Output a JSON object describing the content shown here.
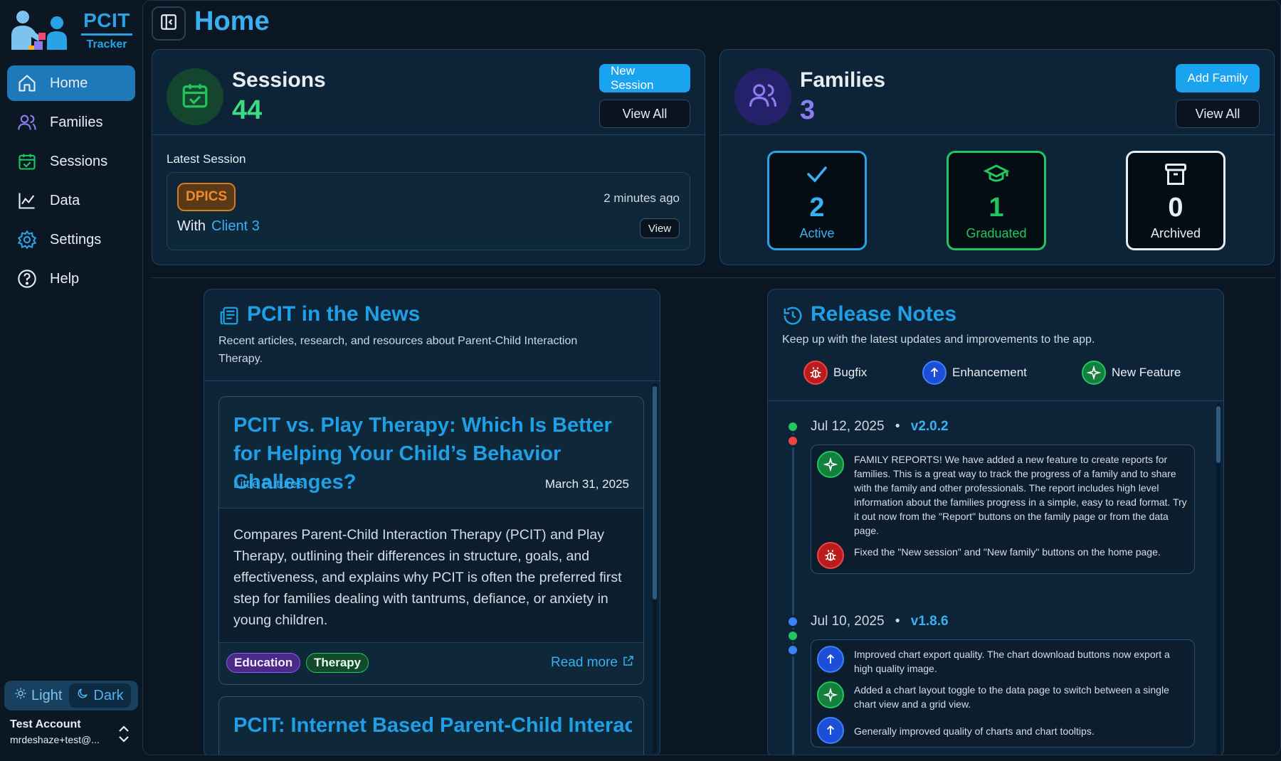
{
  "app": {
    "name": "PCIT",
    "sub": "Tracker"
  },
  "page_title": "Home",
  "nav": [
    {
      "label": "Home"
    },
    {
      "label": "Families"
    },
    {
      "label": "Sessions"
    },
    {
      "label": "Data"
    },
    {
      "label": "Settings"
    },
    {
      "label": "Help"
    }
  ],
  "theme": {
    "light": "Light",
    "dark": "Dark"
  },
  "account": {
    "name": "Test Account",
    "email": "mrdeshaze+test@..."
  },
  "sessions": {
    "title": "Sessions",
    "count": "44",
    "new_label": "New Session",
    "view_all": "View All",
    "latest_label": "Latest Session",
    "latest": {
      "type": "DPICS",
      "ago": "2 minutes ago",
      "with": "With",
      "client": "Client 3",
      "view": "View"
    }
  },
  "families": {
    "title": "Families",
    "count": "3",
    "add_label": "Add Family",
    "view_all": "View All",
    "stats": [
      {
        "value": "2",
        "label": "Active"
      },
      {
        "value": "1",
        "label": "Graduated"
      },
      {
        "value": "0",
        "label": "Archived"
      }
    ]
  },
  "news": {
    "title": "PCIT in the News",
    "subtitle": "Recent articles, research, and resources about Parent-Child Interaction Therapy.",
    "articles": [
      {
        "title": "PCIT vs. Play Therapy: Which Is Better for Helping Your Child’s Behavior Challenges?",
        "source": "Little Futures",
        "date": "March 31, 2025",
        "summary": "Compares Parent-Child Interaction Therapy (PCIT) and Play Therapy, outlining their differences in structure, goals, and effectiveness, and explains why PCIT is often the preferred first step for families dealing with tantrums, defiance, or anxiety in young children.",
        "tags": [
          "Education",
          "Therapy"
        ],
        "read_more": "Read more"
      },
      {
        "title": "PCIT: Internet Based Parent-Child Interaction Th..."
      }
    ]
  },
  "release": {
    "title": "Release Notes",
    "subtitle": "Keep up with the latest updates and improvements to the app.",
    "legend": [
      "Bugfix",
      "Enhancement",
      "New Feature"
    ],
    "entries": [
      {
        "date": "Jul 12, 2025",
        "sep": "•",
        "version": "v2.0.2",
        "items": [
          {
            "type": "feature",
            "text": "FAMILY REPORTS! We have added a new feature to create reports for families. This is a great way to track the progress of a family and to share with the family and other professionals. The report includes high level information about the families progress in a simple, easy to read format. Try it out now from the \"Report\" buttons on the family page or from the data page."
          },
          {
            "type": "bugfix",
            "text": "Fixed the \"New session\" and \"New family\" buttons on the home page."
          }
        ]
      },
      {
        "date": "Jul 10, 2025",
        "sep": "•",
        "version": "v1.8.6",
        "items": [
          {
            "type": "enhancement",
            "text": "Improved chart export quality. The chart download buttons now export a high quality image."
          },
          {
            "type": "feature",
            "text": "Added a chart layout toggle to the data page to switch between a single chart view and a grid view."
          },
          {
            "type": "enhancement",
            "text": "Generally improved quality of charts and chart tooltips."
          }
        ]
      }
    ]
  },
  "colors": {
    "accent": "#1aa3ee",
    "green": "#22c55e",
    "red": "#ef4444",
    "blue": "#3b82f6",
    "purple": "#8b7cf0",
    "orange": "#f08a2a"
  }
}
